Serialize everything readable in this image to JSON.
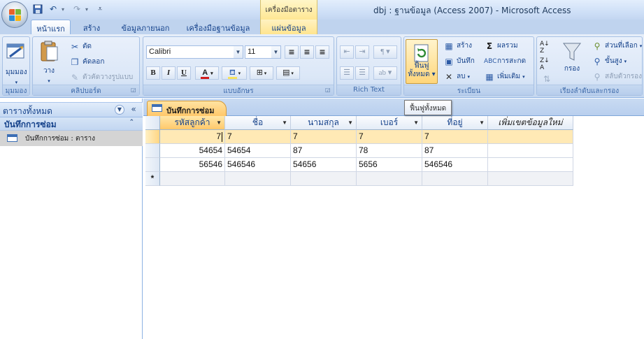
{
  "window": {
    "title": "dbj : ฐานข้อมูล (Access 2007) - Microsoft Access",
    "context_tab_group": "เครื่องมือตาราง"
  },
  "tabs": [
    {
      "label": "หน้าแรก",
      "active": true
    },
    {
      "label": "สร้าง"
    },
    {
      "label": "ข้อมูลภายนอก"
    },
    {
      "label": "เครื่องมือฐานข้อมูล"
    },
    {
      "label": "แผ่นข้อมูล",
      "contextual": true
    }
  ],
  "ribbon": {
    "views": {
      "view_label": "มุมมอง",
      "group_label": "มุมมอง"
    },
    "clipboard": {
      "paste_label": "วาง",
      "cut_label": "ตัด",
      "copy_label": "คัดลอก",
      "format_painter_label": "ตัวคัดวางรูปแบบ",
      "group_label": "คลิปบอร์ด"
    },
    "font": {
      "font_name": "Calibri",
      "font_size": "11",
      "group_label": "แบบอักษร",
      "bold": "B",
      "italic": "I",
      "underline": "U"
    },
    "rich_text": {
      "group_label": "Rich Text"
    },
    "records": {
      "refresh_label_1": "ฟื้นฟู",
      "refresh_label_2": "ทั้งหมด",
      "new_label": "สร้าง",
      "save_label": "บันทึก",
      "delete_label": "ลบ",
      "totals_label": "ผลรวม",
      "spelling_label": "การสะกด",
      "more_label": "เพิ่มเติม",
      "group_label": "ระเบียน"
    },
    "sort_filter": {
      "filter_label": "กรอง",
      "selection_label": "ส่วนที่เลือก",
      "advanced_label": "ขั้นสูง",
      "toggle_filter_label": "สลับตัวกรอง",
      "group_label": "เรียงลำดับและกรอง"
    }
  },
  "tooltip": {
    "text": "ฟื้นฟูทั้งหมด"
  },
  "nav_pane": {
    "header": "ตารางทั้งหมด",
    "group": "บันทึกการซ่อม",
    "items": [
      {
        "label": "บันทึกการซ่อม : ตาราง"
      }
    ]
  },
  "document": {
    "tab_label": "บันทึกการซ่อม",
    "columns": [
      "รหัสลูกค้า",
      "ชื่อ",
      "นามสกุล",
      "เบอร์",
      "ที่อยู่",
      "เพิ่มเขตข้อมูลใหม่"
    ],
    "rows": [
      [
        "7",
        "7",
        "7",
        "7",
        "7"
      ],
      [
        "54654",
        "54654",
        "87",
        "78",
        "87"
      ],
      [
        "56546",
        "546546",
        "54656",
        "5656",
        "546546"
      ]
    ],
    "new_row_marker": "*"
  }
}
